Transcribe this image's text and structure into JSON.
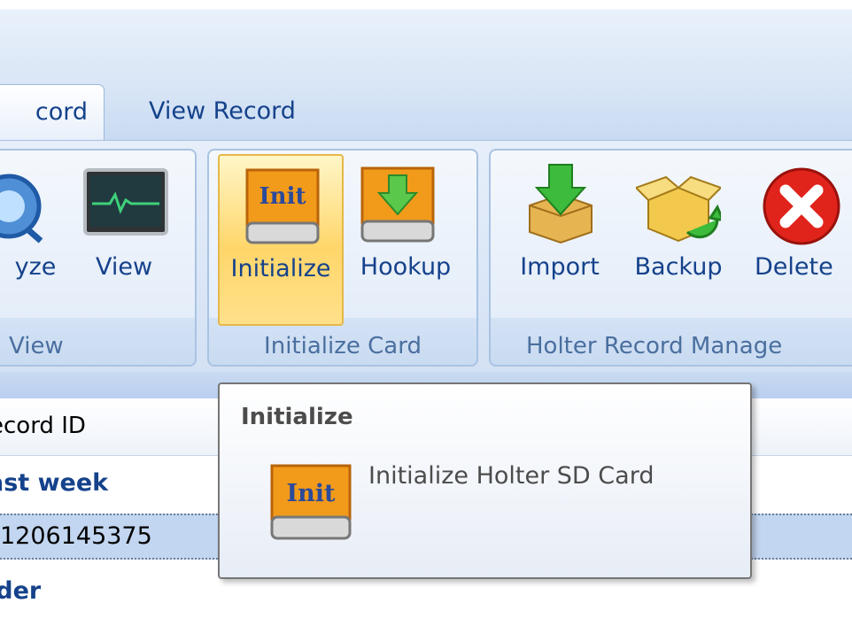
{
  "tabs": [
    {
      "label": "cord",
      "active": true
    },
    {
      "label": "View Record",
      "active": false
    }
  ],
  "groups": {
    "view": {
      "label": "View",
      "buttons": [
        {
          "label": "yze",
          "icon": "analyze-icon"
        },
        {
          "label": "View",
          "icon": "monitor-icon"
        }
      ]
    },
    "initialize_card": {
      "label": "Initialize Card",
      "buttons": [
        {
          "label": "Initialize",
          "icon": "sd-card-init-icon",
          "icon_text": "Init"
        },
        {
          "label": "Hookup",
          "icon": "sd-card-hookup-icon"
        }
      ]
    },
    "holter_record_manage": {
      "label": "Holter Record Manage",
      "buttons": [
        {
          "label": "Import",
          "icon": "import-box-icon"
        },
        {
          "label": "Backup",
          "icon": "backup-box-icon"
        },
        {
          "label": "Delete",
          "icon": "delete-icon"
        }
      ]
    }
  },
  "list": {
    "column_header": "ecord ID",
    "groups": [
      {
        "label": "ast week"
      },
      {
        "label": "lder"
      }
    ],
    "selected_row": "1206145375"
  },
  "tooltip": {
    "title": "Initialize",
    "description": "Initialize Holter SD Card",
    "icon_text": "Init"
  },
  "colors": {
    "ribbon_text": "#15428b",
    "highlight": "#ffd66a",
    "selected_row": "#c2d6f1"
  }
}
